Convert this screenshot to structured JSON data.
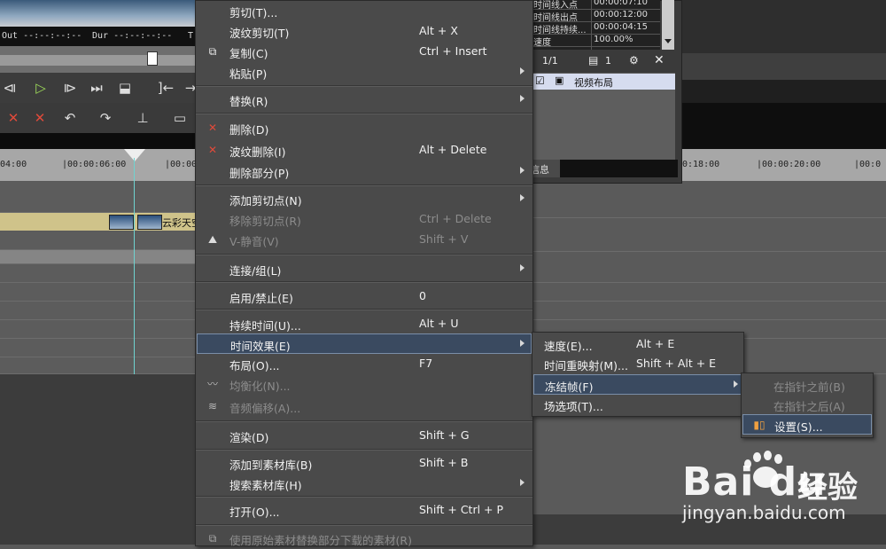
{
  "player": {
    "timecode_out": "Out --:--:--:--",
    "timecode_dur": "Dur --:--:--:--",
    "timecode_t": "T"
  },
  "timeline": {
    "ruler_left": [
      "04:00",
      "|00:00:06:00",
      "|00:00:0"
    ],
    "ruler_right": [
      "0:18:00",
      "|00:00:20:00",
      "|00:0"
    ],
    "clip_label": "云彩天空"
  },
  "info_panel": {
    "rows": [
      {
        "label": "时间线入点",
        "value": "00:00:07:10"
      },
      {
        "label": "时间线出点",
        "value": "00:00:12:00"
      },
      {
        "label": "时间线持续...",
        "value": "00:00:04:15"
      },
      {
        "label": "速度",
        "value": "100.00%"
      }
    ],
    "page_indicator": "1/1",
    "count": "1",
    "layout_item": "视频布局",
    "status_fragment": "信息"
  },
  "main_menu": {
    "items": [
      {
        "label": "剪切(T)...",
        "shortcut": ""
      },
      {
        "label": "波纹剪切(T)",
        "shortcut": "Alt + X"
      },
      {
        "label": "复制(C)",
        "shortcut": "Ctrl + Insert"
      },
      {
        "label": "粘贴(P)",
        "shortcut": ""
      },
      {
        "label": "替换(R)",
        "shortcut": ""
      },
      {
        "label": "删除(D)",
        "shortcut": ""
      },
      {
        "label": "波纹删除(I)",
        "shortcut": "Alt + Delete"
      },
      {
        "label": "删除部分(P)",
        "shortcut": ""
      },
      {
        "label": "添加剪切点(N)",
        "shortcut": ""
      },
      {
        "label": "移除剪切点(R)",
        "shortcut": "Ctrl + Delete"
      },
      {
        "label": "V-静音(V)",
        "shortcut": "Shift + V"
      },
      {
        "label": "连接/组(L)",
        "shortcut": ""
      },
      {
        "label": "启用/禁止(E)",
        "shortcut": "0"
      },
      {
        "label": "持续时间(U)...",
        "shortcut": "Alt + U"
      },
      {
        "label": "时间效果(E)",
        "shortcut": ""
      },
      {
        "label": "布局(O)...",
        "shortcut": "F7"
      },
      {
        "label": "均衡化(N)...",
        "shortcut": ""
      },
      {
        "label": "音频偏移(A)...",
        "shortcut": ""
      },
      {
        "label": "渲染(D)",
        "shortcut": "Shift + G"
      },
      {
        "label": "添加到素材库(B)",
        "shortcut": "Shift + B"
      },
      {
        "label": "搜索素材库(H)",
        "shortcut": ""
      },
      {
        "label": "打开(O)...",
        "shortcut": "Shift + Ctrl + P"
      },
      {
        "label": "使用原始素材替换部分下载的素材(R)",
        "shortcut": ""
      }
    ]
  },
  "time_effect_menu": {
    "items": [
      {
        "label": "速度(E)...",
        "shortcut": "Alt + E"
      },
      {
        "label": "时间重映射(M)...",
        "shortcut": "Shift + Alt + E"
      },
      {
        "label": "冻结帧(F)",
        "shortcut": ""
      },
      {
        "label": "场选项(T)...",
        "shortcut": ""
      }
    ]
  },
  "freeze_menu": {
    "items": [
      {
        "label": "在指针之前(B)"
      },
      {
        "label": "在指针之后(A)"
      },
      {
        "label": "设置(S)..."
      }
    ]
  },
  "watermark": {
    "brand_word": "Bai du",
    "brand_cn": "经验",
    "url": "jingyan.baidu.com"
  }
}
